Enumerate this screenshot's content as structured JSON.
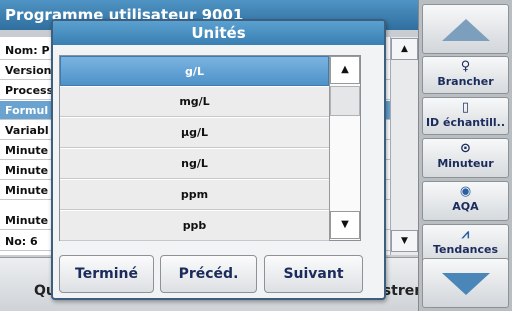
{
  "background": {
    "title": "Programme utilisateur   9001",
    "rows": [
      "Nom: P",
      "Version",
      "Process",
      "Formul",
      "Variabl",
      "Minute",
      "Minute",
      "Minute",
      "Minute",
      "No: 6"
    ],
    "bottom_left": "Qu",
    "bottom_right": "istrer"
  },
  "sidebar": {
    "buttons": [
      {
        "icon": "person-icon",
        "glyph": "🯅",
        "label": "Brancher"
      },
      {
        "icon": "sample-vial-icon",
        "glyph": "⊓",
        "label": "ID échantill.."
      },
      {
        "icon": "timer-icon",
        "glyph": "◎",
        "label": "Minuteur"
      },
      {
        "icon": "aqa-icon",
        "glyph": "◉",
        "label": "AQA"
      },
      {
        "icon": "trend-chart-icon",
        "glyph": "∿",
        "label": "Tendances"
      }
    ]
  },
  "dialog": {
    "title": "Unités",
    "options": [
      "g/L",
      "mg/L",
      "µg/L",
      "ng/L",
      "ppm",
      "ppb"
    ],
    "selected_index": 0,
    "buttons": {
      "done": "Terminé",
      "prev": "Précéd.",
      "next": "Suivant"
    }
  },
  "colors": {
    "accent": "#4f92c9",
    "title_bar": "#3a7fb2",
    "button_text": "#1b2b5c"
  }
}
